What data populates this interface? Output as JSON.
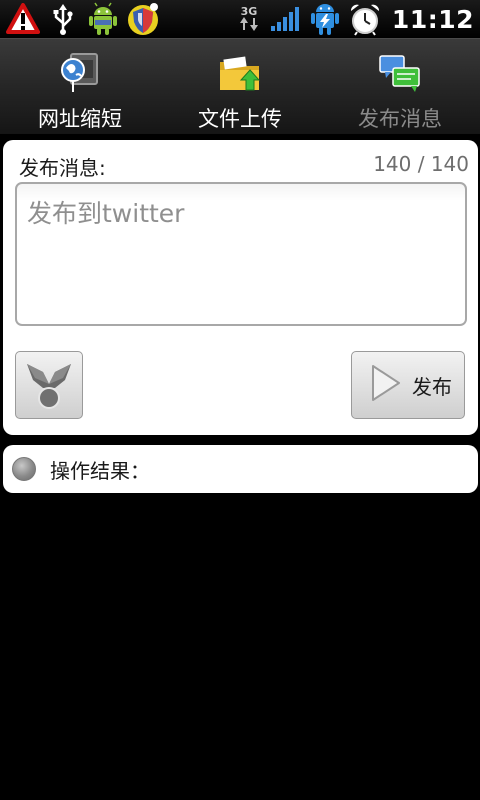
{
  "status_bar": {
    "left_icons": [
      "warning-icon",
      "usb-icon",
      "android-icon",
      "security-shield-icon"
    ],
    "network_type": "3G",
    "right_icons": [
      "signal-strength-icon",
      "battery-charging-icon",
      "alarm-clock-icon"
    ],
    "time": "11:12"
  },
  "tabs": [
    {
      "label": "网址缩短",
      "icon": "url-shorten-icon",
      "selected": false
    },
    {
      "label": "文件上传",
      "icon": "folder-upload-icon",
      "selected": false
    },
    {
      "label": "发布消息",
      "icon": "post-message-icon",
      "selected": true
    }
  ],
  "compose": {
    "label": "发布消息:",
    "counter": "140 / 140",
    "input_value": "",
    "placeholder": "发布到twitter",
    "shorten_button_icon": "link-shortener-icon",
    "publish_label": "发布",
    "publish_icon": "play-arrow-icon"
  },
  "result": {
    "label": "操作结果："
  },
  "colors": {
    "background": "#000000",
    "panel": "#ffffff",
    "tab_selected_text": "#8a8a8a",
    "tab_text": "#ffffff"
  }
}
